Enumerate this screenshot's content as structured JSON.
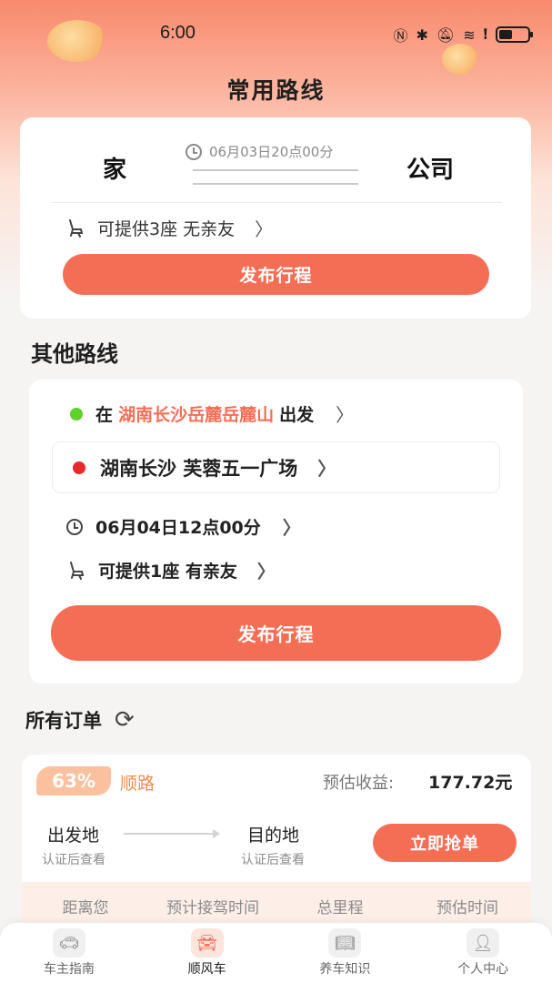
{
  "status_bar": {
    "time": "6:00",
    "icons": [
      "nfc-icon",
      "bluetooth-icon",
      "mute-icon",
      "wifi-icon",
      "alert-icon",
      "battery-icon"
    ]
  },
  "page": {
    "title": "常用路线"
  },
  "common_route": {
    "from": "家",
    "to": "公司",
    "time": "06月03日20点00分",
    "seats": "可提供3座 无亲友",
    "publish_button": "发布行程"
  },
  "other_routes": {
    "section_title": "其他路线",
    "origin_prefix": "在",
    "origin_place": "湖南长沙岳麓岳麓山",
    "origin_suffix": "出发",
    "destination": "湖南长沙 芙蓉五一广场",
    "time": "06月04日12点00分",
    "seats": "可提供1座 有亲友",
    "publish_button": "发布行程",
    "origin_dot_color": "#5fd12a",
    "destination_dot_color": "#e8282b"
  },
  "orders": {
    "section_title": "所有订单",
    "order": {
      "match_percent": "63%",
      "match_percent_value": 63,
      "tag": "顺路",
      "income_label": "预估收益:",
      "income_value": "177.72元",
      "from_label": "出发地",
      "from_sub": "认证后查看",
      "to_label": "目的地",
      "to_sub": "认证后查看",
      "grab_button": "立即抢单",
      "stats_headers": [
        "距离您",
        "预计接驾时间",
        "总里程",
        "预估时间"
      ]
    }
  },
  "tabbar": {
    "tabs": [
      {
        "label": "车主指南",
        "icon": "car-icon"
      },
      {
        "label": "顺风车",
        "icon": "ride-icon",
        "active": true
      },
      {
        "label": "养车知识",
        "icon": "book-icon"
      },
      {
        "label": "个人中心",
        "icon": "user-icon"
      }
    ]
  },
  "colors": {
    "accent": "#f46e56",
    "header_gradient_top": "#f88a6c",
    "badge": "#fbc09e"
  }
}
